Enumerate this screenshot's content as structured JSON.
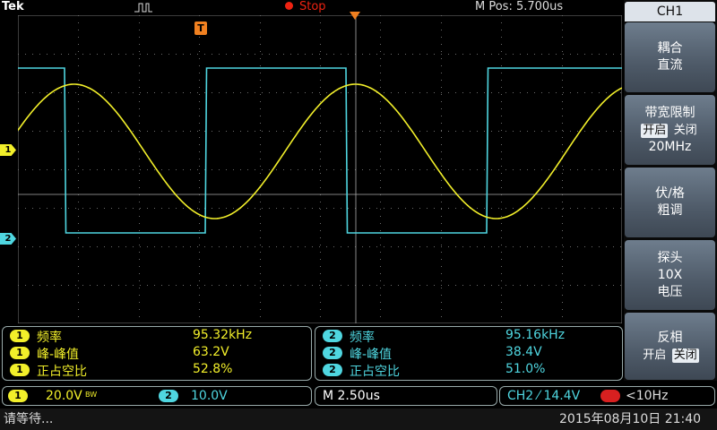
{
  "topbar": {
    "brand": "Tek",
    "run_state": "Stop",
    "horizontal_position": "M Pos: 5.700us"
  },
  "trigger_marker": "T",
  "channel_markers": {
    "ch1": "1",
    "ch2": "2"
  },
  "menu": {
    "title": "CH1",
    "buttons": [
      {
        "line1": "耦合",
        "line2": "直流"
      },
      {
        "line1": "带宽限制",
        "opt_a": "开启",
        "opt_b": "关闭",
        "selected": "开启",
        "line3": "20MHz"
      },
      {
        "line1": "伏/格",
        "line2": "粗调"
      },
      {
        "line1": "探头",
        "line2": "10X",
        "line3": "电压"
      },
      {
        "line1": "反相",
        "opt_a": "开启",
        "opt_b": "关闭",
        "selected": "关闭"
      }
    ]
  },
  "measurements": {
    "ch1": [
      {
        "ch": "1",
        "label": "频率",
        "value": "95.32kHz"
      },
      {
        "ch": "1",
        "label": "峰-峰值",
        "value": "63.2V"
      },
      {
        "ch": "1",
        "label": "正占空比",
        "value": "52.8%"
      }
    ],
    "ch2": [
      {
        "ch": "2",
        "label": "频率",
        "value": "95.16kHz"
      },
      {
        "ch": "2",
        "label": "峰-峰值",
        "value": "38.4V"
      },
      {
        "ch": "2",
        "label": "正占空比",
        "value": "51.0%"
      }
    ]
  },
  "scale": {
    "ch1_badge": "1",
    "ch1_volts": "20.0V",
    "ch1_bw": "BW",
    "ch2_badge": "2",
    "ch2_volts": "10.0V",
    "timebase": "M 2.50us",
    "trigger": "CH2 ⁄ 14.4V",
    "trigger_freq": "<10Hz"
  },
  "status": {
    "message": "请等待...",
    "datetime": "2015年08月10日 21:40"
  },
  "colors": {
    "ch1": "#f2ef2a",
    "ch2": "#4fd6e0",
    "grid": "#6b6b6b",
    "stop": "#e21111",
    "trigger": "#f08020"
  }
}
